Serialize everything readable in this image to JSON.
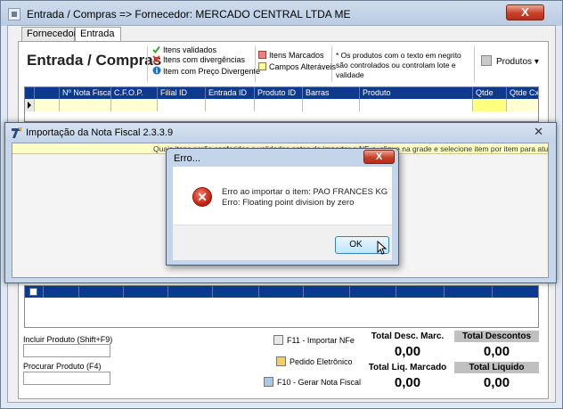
{
  "main_window": {
    "title": "Entrada / Compras => Fornecedor: MERCADO CENTRAL LTDA ME",
    "close_symbol": "X"
  },
  "tabs": [
    {
      "label": "Fornecedores"
    },
    {
      "label": "Entrada"
    }
  ],
  "page_title": "Entrada / Compras",
  "legend": {
    "validated": "Itens validados",
    "divergent": "Itens com divergências",
    "price_divergent": "Item com Preço Divergente",
    "marked": "Itens Marcados",
    "editable": "Campos Alteráveis",
    "colors": {
      "validated": "#3aa63a",
      "divergent": "#d23a2a",
      "marked": "#f08080",
      "editable": "#ffffa0",
      "info": "#1f6fd0"
    }
  },
  "note": "* Os produtos com o texto em negrito são controlados ou controlam lote e validade",
  "products_button": "Produtos",
  "grid_columns": [
    "",
    "Nº Nota Fiscal",
    "C.F.O.P.",
    "Filial ID",
    "Entrada ID",
    "Produto ID",
    "Barras",
    "Produto",
    "Qtde",
    "Qtde Cx."
  ],
  "import_window": {
    "title": "Importação da Nota Fiscal 2.3.3.9",
    "banner": "Quais itens serão conferidos e validados antes de importar a NF-e, clique na grade e selecione item por item para atualizar..."
  },
  "error_dialog": {
    "title": "Erro...",
    "close_symbol": "X",
    "icon": "error-icon",
    "line1": "Erro ao importar o item: PAO FRANCES KG",
    "line2": "Erro: Floating point division by zero",
    "ok_label": "OK"
  },
  "fields": {
    "incluir_label": "Incluir Produto (Shift+F9)",
    "procurar_label": "Procurar Produto (F4)",
    "incluir_value": "",
    "procurar_value": ""
  },
  "actions": {
    "import_nfe": "F11 - Importar NFe",
    "pedido": "Pedido Eletrônico",
    "gerar": "F10 - Gerar Nota Fiscal"
  },
  "totals": {
    "desc_marc_label": "Total Desc. Marc.",
    "desc_marc_value": "0,00",
    "descontos_label": "Total Descontos",
    "descontos_value": "0,00",
    "liq_marcado_label": "Total Liq. Marcado",
    "liq_marcado_value": "0,00",
    "liquido_label": "Total Liquido",
    "liquido_value": "0,00"
  }
}
